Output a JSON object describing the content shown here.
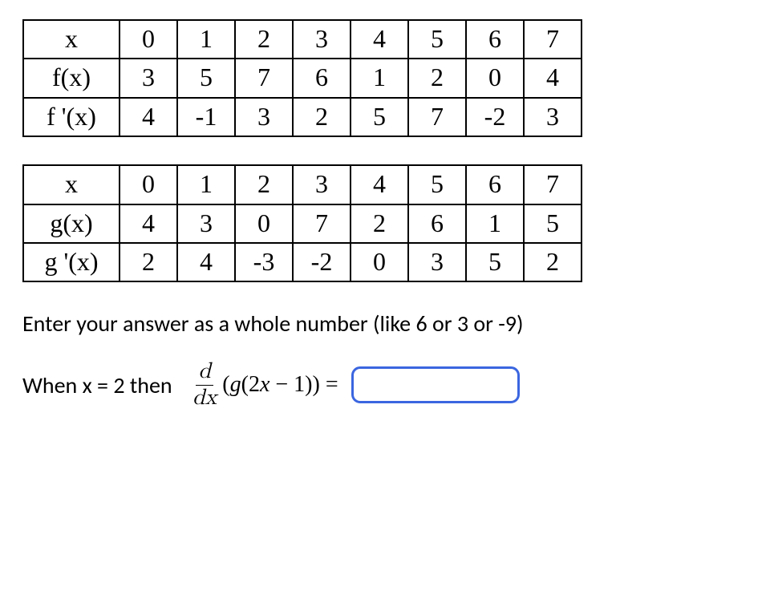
{
  "table1": {
    "r0": {
      "label": "x",
      "c0": "0",
      "c1": "1",
      "c2": "2",
      "c3": "3",
      "c4": "4",
      "c5": "5",
      "c6": "6",
      "c7": "7"
    },
    "r1": {
      "label": "f(x)",
      "c0": "3",
      "c1": "5",
      "c2": "7",
      "c3": "6",
      "c4": "1",
      "c5": "2",
      "c6": "0",
      "c7": "4"
    },
    "r2": {
      "label": "f '(x)",
      "c0": "4",
      "c1": "-1",
      "c2": "3",
      "c3": "2",
      "c4": "5",
      "c5": "7",
      "c6": "-2",
      "c7": "3"
    }
  },
  "table2": {
    "r0": {
      "label": "x",
      "c0": "0",
      "c1": "1",
      "c2": "2",
      "c3": "3",
      "c4": "4",
      "c5": "5",
      "c6": "6",
      "c7": "7"
    },
    "r1": {
      "label": "g(x)",
      "c0": "4",
      "c1": "3",
      "c2": "0",
      "c3": "7",
      "c4": "2",
      "c5": "6",
      "c6": "1",
      "c7": "5"
    },
    "r2": {
      "label": "g '(x)",
      "c0": "2",
      "c1": "4",
      "c2": "-3",
      "c3": "-2",
      "c4": "0",
      "c5": "3",
      "c6": "5",
      "c7": "2"
    }
  },
  "question": {
    "instruction": "Enter your answer as a whole number (like 6 or 3 or -9)",
    "when_prefix": "When x = 2 then",
    "frac_num": "d",
    "frac_den": "dx",
    "expr": "(g(2x − 1)) =",
    "answer_value": ""
  }
}
